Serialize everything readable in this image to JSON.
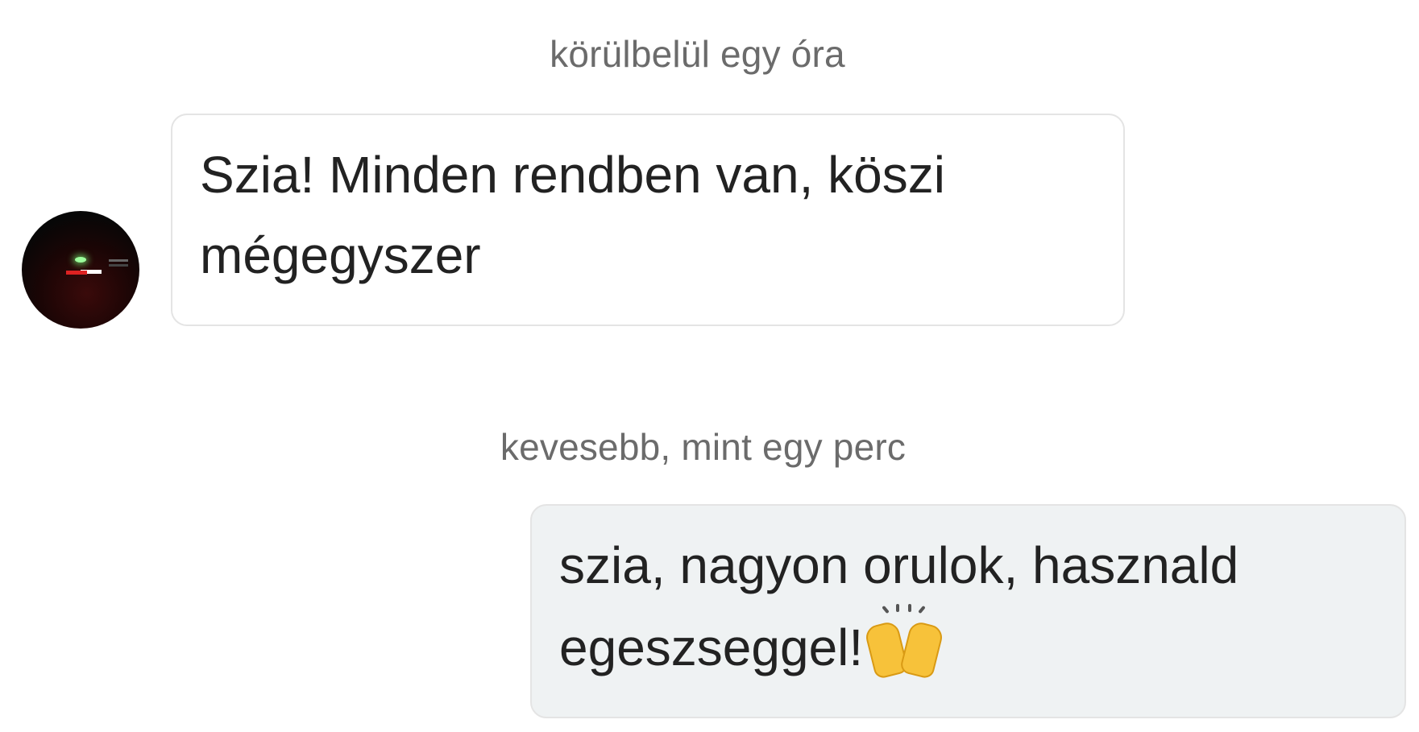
{
  "messages": [
    {
      "timestamp": "körülbelül egy óra",
      "direction": "incoming",
      "lines": [
        "Szia! Minden rendben van, köszi",
        "mégegyszer"
      ]
    },
    {
      "timestamp": "kevesebb, mint egy perc",
      "direction": "outgoing",
      "lines": [
        "szia, nagyon orulok, hasznald",
        "egeszseggel!"
      ],
      "emoji": "raising-hands-icon"
    }
  ],
  "colors": {
    "timestamp": "#6b6b6b",
    "incoming_bg": "#ffffff",
    "outgoing_bg": "#eff2f3",
    "bubble_border": "#e4e4e4",
    "text": "#222222"
  }
}
